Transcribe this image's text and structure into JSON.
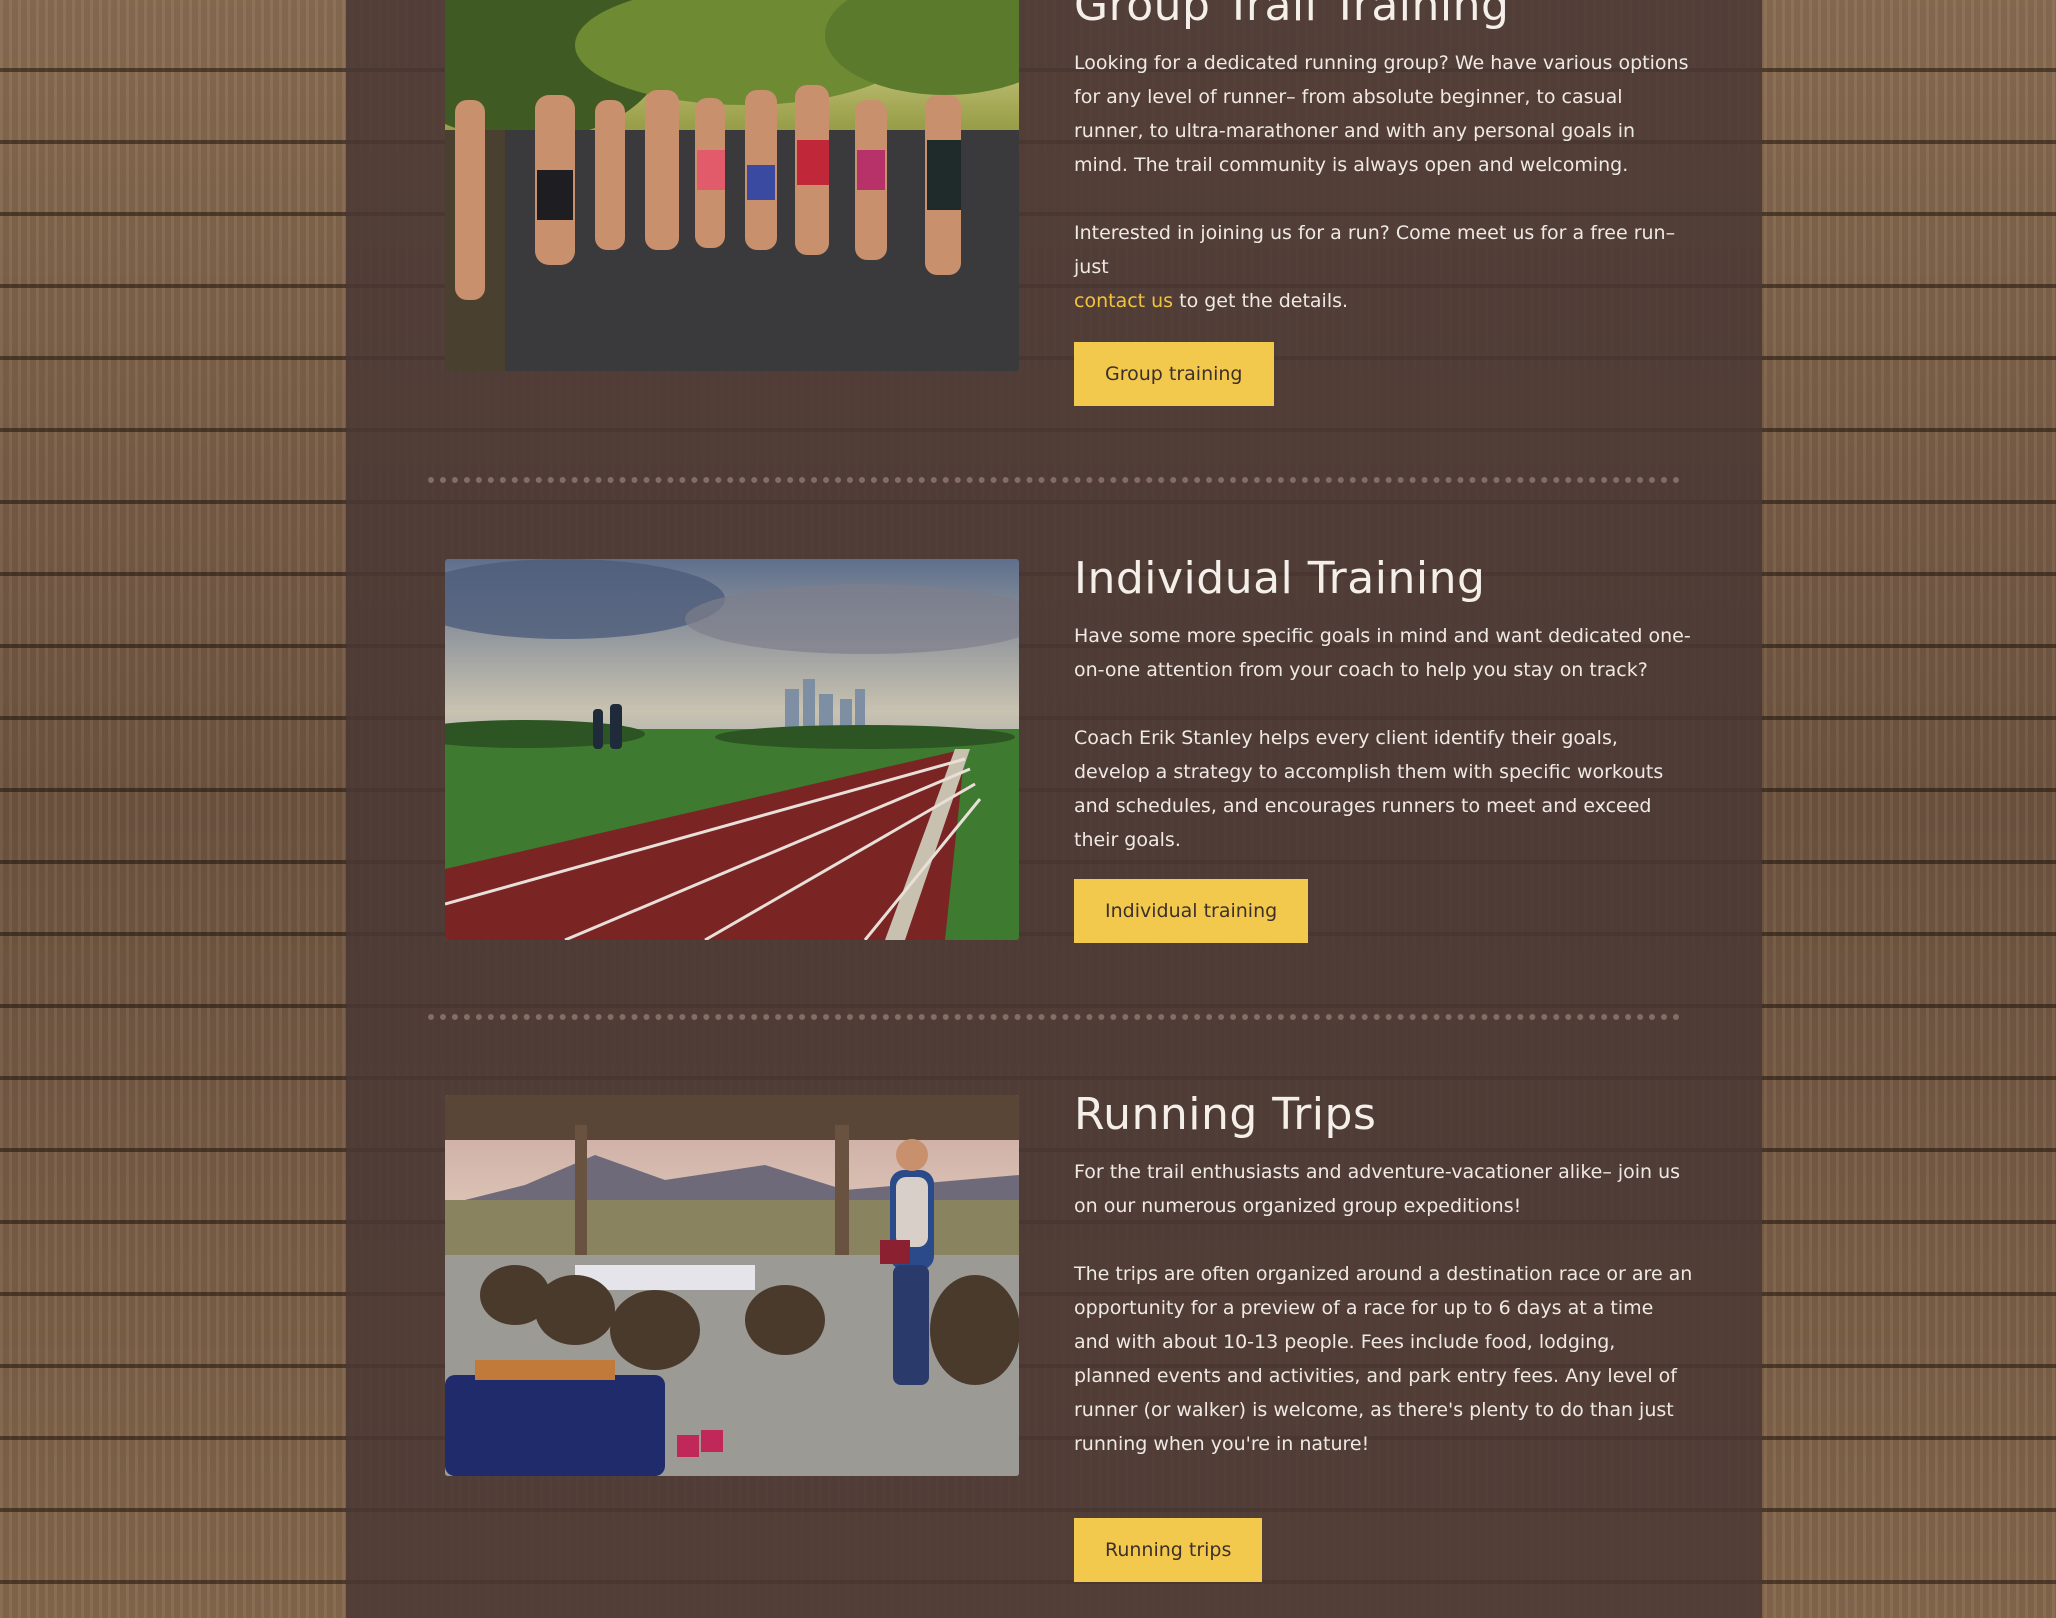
{
  "sections": [
    {
      "title": "Group Trail Training",
      "paragraphs": [
        "Looking for a dedicated running group?  We have various options for any level of runner– from absolute beginner, to casual runner, to ultra-marathoner and with any personal goals in mind. The trail community is always open and welcoming.",
        "Interested in joining us for a run? Come meet us for a free run– just"
      ],
      "link_text": "contact us",
      "after_link_text": " to get the details.",
      "button_label": "Group training"
    },
    {
      "title": "Individual Training",
      "paragraphs": [
        "Have some more  specific goals in mind and want dedicated one-on-one attention from your coach to help you stay on track?",
        "Coach Erik Stanley helps every client identify their goals, develop a strategy to accomplish them with specific workouts and schedules, and encourages runners to meet and exceed their goals."
      ],
      "button_label": "Individual training"
    },
    {
      "title": "Running Trips",
      "paragraphs": [
        "For the trail enthusiasts and adventure-vacationer alike– join us on our numerous organized group expeditions!",
        "The trips are often organized around a destination race or are an opportunity for a preview of a race for up to 6 days at a time and with about 10-13 people. Fees include food, lodging, planned events and activities, and park entry fees.   Any level of runner (or walker) is welcome, as there's plenty to do than just running when you're in nature!"
      ],
      "button_label": "Running trips"
    }
  ],
  "colors": {
    "accent": "#f2c94c",
    "link": "#f2c43d",
    "panel": "#4a3834",
    "text": "#efe9e4"
  }
}
